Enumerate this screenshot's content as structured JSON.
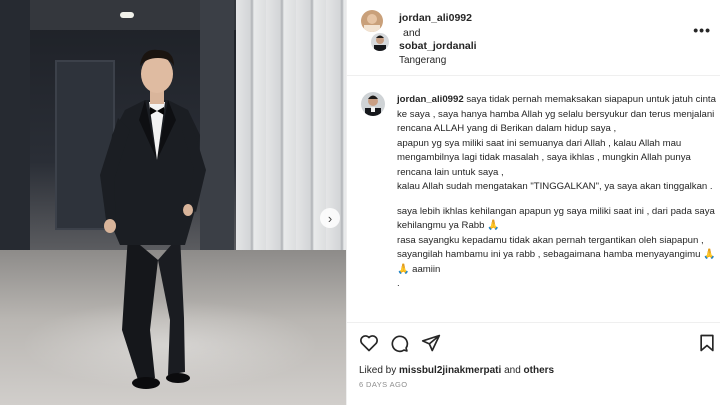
{
  "post": {
    "author": "jordan_ali0992",
    "and_text": "and",
    "collaborator": "sobat_jordanali",
    "location": "Tangerang",
    "more_icon": "more-horizontal-icon"
  },
  "caption": {
    "username": "jordan_ali0992",
    "first_line": "saya tidak pernah memaksakan siapapun untuk jatuh cinta ke saya , saya hanya hamba Allah yg selalu bersyukur dan terus menjalani rencana ALLAH yang di Berikan dalam hidup saya ,",
    "lines": [
      "apapun yg sya miliki saat ini semuanya dari Allah , kalau Allah mau mengambilnya lagi tidak masalah , saya ikhlas , mungkin Allah punya rencana lain untuk saya ,",
      "kalau Allah sudah mengatakan \"TINGGALKAN\", ya saya akan tinggalkan ."
    ],
    "para2_lines": [
      "saya lebih ikhlas kehilangan apapun yg saya miliki saat ini , dari pada saya kehilangmu ya Rabb"
    ],
    "para3": "rasa sayangku kepadamu tidak akan pernah tergantikan oleh siapapun , sayangilah hambamu ini ya rabb , sebagaimana hamba menyayangimu",
    "para3_tail": "aamiin",
    "trailing": "."
  },
  "actions": {
    "icons": [
      "heart-icon",
      "comment-icon",
      "share-icon",
      "bookmark-icon"
    ]
  },
  "likes": {
    "prefix": "Liked by",
    "user": "missbul2jinakmerpati",
    "and": "and",
    "others": "others"
  },
  "timestamp": "6 DAYS AGO",
  "colors": {
    "text": "#262626",
    "muted": "#8e8e8e",
    "border": "#efefef"
  }
}
